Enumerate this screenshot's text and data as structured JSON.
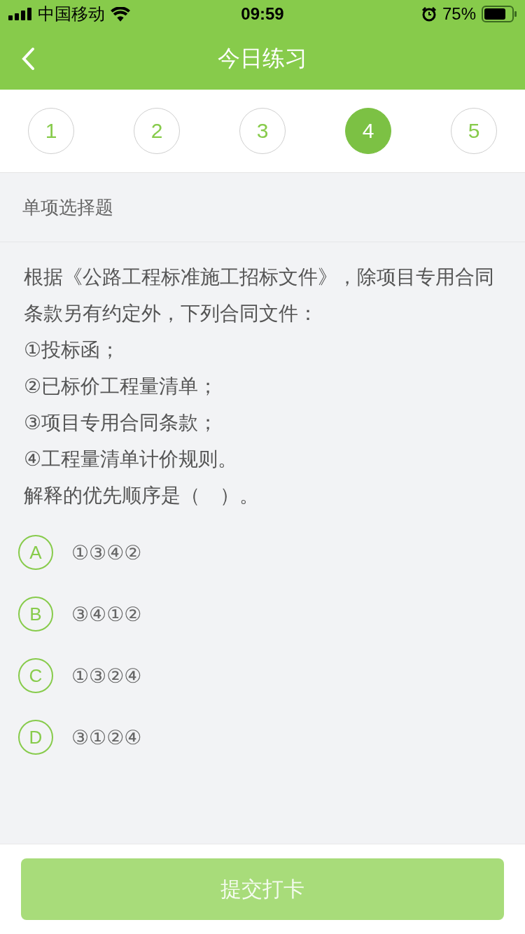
{
  "status_bar": {
    "carrier": "中国移动",
    "time": "09:59",
    "battery": "75%"
  },
  "nav": {
    "title": "今日练习"
  },
  "steps": [
    {
      "label": "1",
      "selected": false
    },
    {
      "label": "2",
      "selected": false
    },
    {
      "label": "3",
      "selected": false
    },
    {
      "label": "4",
      "selected": true
    },
    {
      "label": "5",
      "selected": false
    }
  ],
  "section_title": "单项选择题",
  "question": [
    "根据《公路工程标准施工招标文件》，除项目专用合同条款另有约定外，下列合同文件：",
    "①投标函；",
    "②已标价工程量清单；",
    "③项目专用合同条款；",
    "④工程量清单计价规则。",
    "解释的优先顺序是（　）。"
  ],
  "options": [
    {
      "letter": "A",
      "text": "①③④②",
      "selected": false
    },
    {
      "letter": "B",
      "text": "③④①②",
      "selected": false
    },
    {
      "letter": "C",
      "text": "①③②④",
      "selected": false
    },
    {
      "letter": "D",
      "text": "③①②④",
      "selected": false
    }
  ],
  "submit": {
    "label": "提交打卡",
    "disabled": true
  }
}
